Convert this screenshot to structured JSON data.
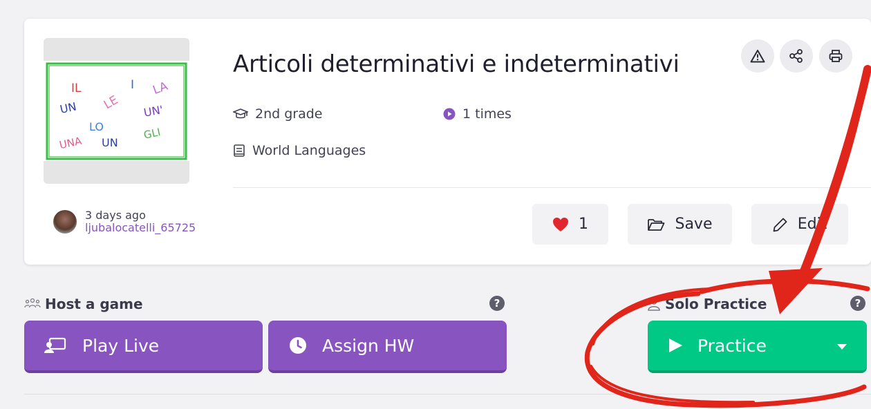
{
  "quiz": {
    "title": "Articoli determinativi e indeterminativi",
    "grade": "2nd grade",
    "plays": "1 times",
    "subject": "World Languages",
    "thumbnail_words": [
      "IL",
      "I",
      "LA",
      "UN",
      "LE",
      "UN'",
      "LO",
      "UNA",
      "UN",
      "GLI"
    ]
  },
  "author": {
    "time": "3 days ago",
    "username": "ljubalocatelli_65725"
  },
  "actions": {
    "like_count": "1",
    "save_label": "Save",
    "edit_label": "Edit"
  },
  "host": {
    "label": "Host a game",
    "play_live": "Play Live",
    "assign_hw": "Assign HW"
  },
  "solo": {
    "label": "Solo Practice",
    "practice": "Practice"
  },
  "icons": {
    "report": "warning-icon",
    "share": "share-icon",
    "print": "printer-icon",
    "grade": "graduation-cap-icon",
    "plays": "play-circle-icon",
    "subject": "book-icon",
    "like": "heart-icon",
    "save": "folder-icon",
    "edit": "pencil-icon",
    "host": "users-icon",
    "play_live": "screen-user-icon",
    "assign": "clock-icon",
    "solo": "user-icon",
    "practice": "play-icon",
    "dropdown": "caret-down-icon",
    "help": "question-icon"
  },
  "colors": {
    "brand_purple": "#8854c0",
    "practice_green": "#00c985",
    "annotation_red": "#e0261b"
  }
}
